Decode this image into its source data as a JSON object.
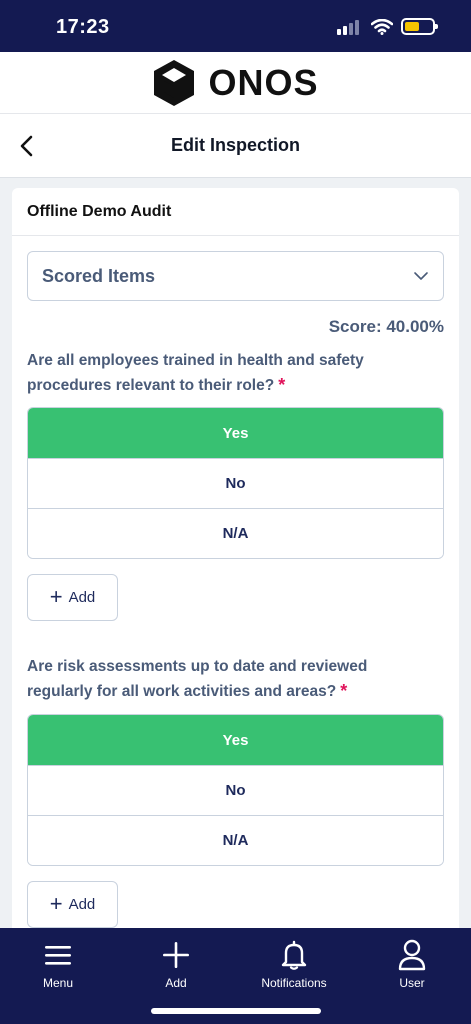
{
  "status_bar": {
    "time": "17:23"
  },
  "brand": {
    "name": "ONOS"
  },
  "header": {
    "title": "Edit Inspection"
  },
  "card": {
    "title": "Offline Demo Audit",
    "section_select": {
      "value": "Scored Items"
    },
    "score_text": "Score: 40.00%",
    "questions": [
      {
        "text": "Are all employees trained in health and safety procedures relevant to their role?",
        "required_mark": "*",
        "options": [
          "Yes",
          "No",
          "N/A"
        ],
        "selected": "Yes",
        "add_label": "Add"
      },
      {
        "text": "Are risk assessments up to date and reviewed regularly for all work activities and areas?",
        "required_mark": "*",
        "options": [
          "Yes",
          "No",
          "N/A"
        ],
        "selected": "Yes",
        "add_label": "Add"
      }
    ]
  },
  "bottom_nav": {
    "items": [
      {
        "label": "Menu",
        "icon": "hamburger-menu-icon"
      },
      {
        "label": "Add",
        "icon": "plus-icon"
      },
      {
        "label": "Notifications",
        "icon": "bell-icon"
      },
      {
        "label": "User",
        "icon": "user-icon"
      }
    ]
  },
  "colors": {
    "navy": "#141a52",
    "selected_green": "#38c172",
    "label_slate": "#4a5b78",
    "required_red": "#e0135a"
  }
}
